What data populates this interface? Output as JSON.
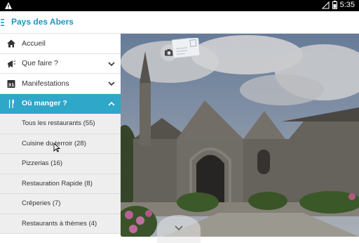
{
  "statusbar": {
    "time": "5:35",
    "icons": [
      "warning-icon",
      "no-signal-icon",
      "battery-icon"
    ]
  },
  "appbar": {
    "title": "Pays des Abers",
    "menu_icon": "hamburger-icon"
  },
  "drawer": {
    "items": [
      {
        "label": "Accueil",
        "icon": "home-icon",
        "expandable": false
      },
      {
        "label": "Que faire ?",
        "icon": "megaphone-icon",
        "expandable": true
      },
      {
        "label": "Manifestations",
        "icon": "calendar-icon",
        "expandable": true
      },
      {
        "label": "Où manger ?",
        "icon": "cutlery-icon",
        "expandable": true,
        "active": true
      }
    ],
    "subitems": [
      {
        "label": "Tous les restaurants (55)"
      },
      {
        "label": "Cuisine du terroir (28)"
      },
      {
        "label": "Pizzerias (16)"
      },
      {
        "label": "Restauration Rapide (8)"
      },
      {
        "label": "Crêperies (7)"
      },
      {
        "label": "Restaurants à thèmes (4)"
      }
    ]
  },
  "colors": {
    "accent": "#2ea7c9",
    "title": "#1e97bd"
  }
}
